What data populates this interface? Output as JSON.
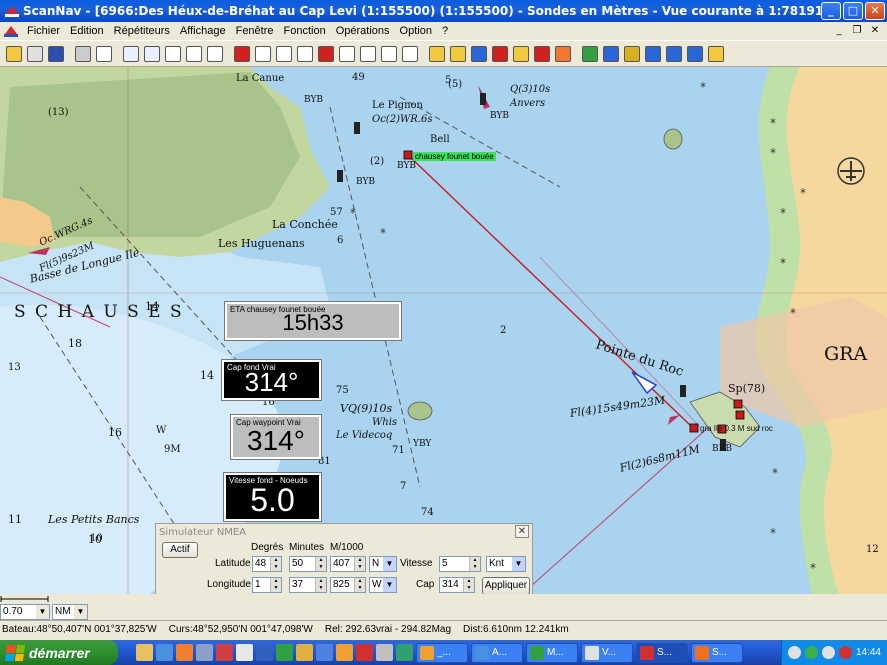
{
  "window": {
    "title": "ScanNav - [6966:Des Héux-de-Bréhat au Cap Levi (1:155500) (1:155500) - Sondes en  Mètres  - Vue courante à 1:78191]",
    "minimize": "_",
    "maximize": "□",
    "close": "✕"
  },
  "menu": {
    "items": [
      "Fichier",
      "Edition",
      "Répétiteurs",
      "Affichage",
      "Fenêtre",
      "Fonction",
      "Opérations",
      "Option",
      "?"
    ],
    "mdi_minimize": "_",
    "mdi_restore": "❐",
    "mdi_close": "✕"
  },
  "toolbar": {
    "buttons": [
      {
        "icon": "open-icon",
        "color": "#f3c940"
      },
      {
        "icon": "print-preview-icon",
        "color": "#e0e0e0"
      },
      {
        "icon": "save-icon",
        "color": "#2d4fb0"
      },
      {
        "icon": "print-icon",
        "color": "#cccccc"
      },
      {
        "icon": "help-pointer-icon",
        "color": "#ffffff"
      },
      {
        "icon": "zoom-in-icon",
        "color": "#e8f0ff"
      },
      {
        "icon": "zoom-out-icon",
        "color": "#e8f0ff"
      },
      {
        "icon": "pan-hand-icon",
        "color": "#ffffff"
      },
      {
        "icon": "select-rect-icon",
        "color": "#ffffff"
      },
      {
        "icon": "select-copy-icon",
        "color": "#ffffff"
      },
      {
        "icon": "mark-icon",
        "color": "#d02020"
      },
      {
        "icon": "crosshair-icon",
        "color": "#ffffff"
      },
      {
        "icon": "route-icon",
        "color": "#ffffff"
      },
      {
        "icon": "route-edit-icon",
        "color": "#ffffff"
      },
      {
        "icon": "track-icon",
        "color": "#d02020"
      },
      {
        "icon": "measure-icon",
        "color": "#ffffff"
      },
      {
        "icon": "bearing-icon",
        "color": "#ffffff"
      },
      {
        "icon": "text-icon",
        "color": "#ffffff"
      },
      {
        "icon": "layers-icon",
        "color": "#ffffff"
      },
      {
        "icon": "gps-icon",
        "color": "#f3c940"
      },
      {
        "icon": "ruler-icon",
        "color": "#f3c940"
      },
      {
        "icon": "north-up-icon",
        "color": "#2a66d8"
      },
      {
        "icon": "center-boat-icon",
        "color": "#d02020"
      },
      {
        "icon": "route-mode-icon",
        "color": "#f3c940"
      },
      {
        "icon": "man-overboard-icon",
        "color": "#d02020"
      },
      {
        "icon": "lifebuoy-icon",
        "color": "#f07830"
      },
      {
        "icon": "instruments-icon",
        "color": "#30a040"
      },
      {
        "icon": "chart-icon",
        "color": "#2a66d8"
      },
      {
        "icon": "grid-icon",
        "color": "#d8b020"
      },
      {
        "icon": "crossing-icon",
        "color": "#2a66d8"
      },
      {
        "icon": "wind-icon",
        "color": "#2a66d8"
      },
      {
        "icon": "arrow-icon",
        "color": "#2a66d8"
      },
      {
        "icon": "context-help-icon",
        "color": "#f3c940"
      }
    ]
  },
  "map": {
    "waypoint_label": "chausey founet bouée",
    "labels": {
      "la_canue": "La Canue",
      "le_pignon": "Le Pignon",
      "oc_wr": "Oc(2)WR.6s",
      "bell": "Bell",
      "byb1": "BYB",
      "byb2": "BYB",
      "byb3": "BYB",
      "byb4": "BYB",
      "q3": "Q(3)10s",
      "anvers": "Anvers",
      "fl5": "(5)",
      "n49": "49",
      "n2_1": "(2)",
      "lahuguenans": "Les Huguenans",
      "laconchee": "La Conchée",
      "basse": "Basse de Longue Ile",
      "schauses": "S  C  H  A  U  S  E  S",
      "pointe": "Pointe du Roc",
      "gran": "GRA",
      "sp78": "Sp(78)",
      "fl4": "Fl(4)15s49m23M",
      "fl2": "Fl(2)6s8m11M",
      "brb": "BRB",
      "grn_label": "gra  Ile 0.3 M sud roc",
      "vq9": "VQ(9)10s",
      "whis": "Whis",
      "levidecoq": "Le Videcoq",
      "yby": "YBY",
      "petitsbancs": "Les Petits Bancs",
      "d13": "(13)",
      "d18": "18",
      "d14": "14",
      "d16": "16",
      "d9": "9M",
      "d10": "10",
      "d11": "11",
      "d12": "12",
      "d7": "7",
      "d5": "5",
      "d2": "2",
      "d6": "6",
      "w": "W",
      "d57": "57",
      "fl_wr": "Fl(5)9s23M",
      "oc_wrg": "Oc.WRG.4s",
      "d131": "13",
      "d142": "14",
      "d167": "16",
      "d71": "71",
      "d75": "75",
      "d81": "81",
      "d74": "74",
      "d109": "10"
    }
  },
  "instruments": {
    "eta": {
      "label": "ETA chausey founet bouée",
      "value": "15h33"
    },
    "cap_fond": {
      "label": "Cap fond Vrai",
      "value": "314°"
    },
    "cap_waypoint": {
      "label": "Cap waypoint Vrai",
      "value": "314°"
    },
    "vitesse": {
      "label": "Vitesse fond - Noeuds",
      "value": "5.0"
    }
  },
  "simulator": {
    "title": "Simulateur NMEA",
    "close": "✕",
    "actif_button": "Actif",
    "col_degres": "Degrés",
    "col_minutes": "Minutes",
    "col_m1000": "M/1000",
    "latitude_label": "Latitude",
    "lat_deg": "48",
    "lat_min": "50",
    "lat_m1000": "407",
    "lat_hem": "N",
    "longitude_label": "Longitude",
    "lon_deg": "1",
    "lon_min": "37",
    "lon_m1000": "825",
    "lon_hem": "W",
    "vitesse_label": "Vitesse",
    "vitesse_value": "5",
    "vitesse_unit": "Knt",
    "cap_label": "Cap",
    "cap_value": "314",
    "appliquer_button": "Appliquer"
  },
  "bottom": {
    "scale_value": "0.70",
    "unit_value": "NM"
  },
  "status": {
    "bateau": "Bateau:48°50,407'N 001°37,825'W",
    "curseur": "Curs:48°52,950'N 001°47,098'W",
    "rel": "Rel: 292.63vrai - 294.82Mag",
    "dist": "Dist:6.610nm  12.241km"
  },
  "taskbar": {
    "start": "démarrer",
    "tasks": [
      {
        "label": "_...",
        "color": "#f0a030"
      },
      {
        "label": "A...",
        "color": "#4a90e0"
      },
      {
        "label": "M...",
        "color": "#30a040"
      },
      {
        "label": "V...",
        "color": "#e0e0e0"
      },
      {
        "label": "S...",
        "color": "#d03030"
      },
      {
        "label": "S...",
        "color": "#f07020"
      }
    ],
    "clock": "14:44"
  }
}
